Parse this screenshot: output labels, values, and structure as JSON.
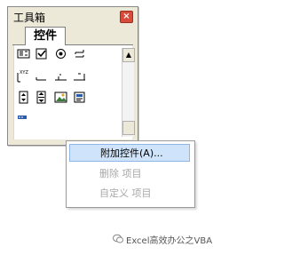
{
  "window": {
    "title": "工具箱",
    "close_symbol": "×"
  },
  "tabs": [
    {
      "label": "控件"
    }
  ],
  "context_menu": {
    "items": [
      {
        "label": "附加控件(A)...",
        "state": "active"
      },
      {
        "label": "删除 项目",
        "state": "disabled"
      },
      {
        "label": "自定义 项目",
        "state": "disabled"
      }
    ]
  },
  "watermark": {
    "text": "Excel高效办公之VBA"
  },
  "colors": {
    "window_bg": "#ece9d8",
    "close_red": "#d84a3a",
    "menu_highlight": "#cfe3fa",
    "disabled_text": "#a8a8a8"
  },
  "toolbox_icons": [
    "label-icon",
    "checkbox-icon",
    "optionbutton-icon",
    "togglebutton-icon",
    "frame-icon",
    "commandbutton-icon",
    "tabstrip-icon",
    "multipage-icon",
    "spinbutton-icon",
    "scrollbar-icon",
    "image-icon",
    "refedit-icon",
    "textbox-icon"
  ]
}
